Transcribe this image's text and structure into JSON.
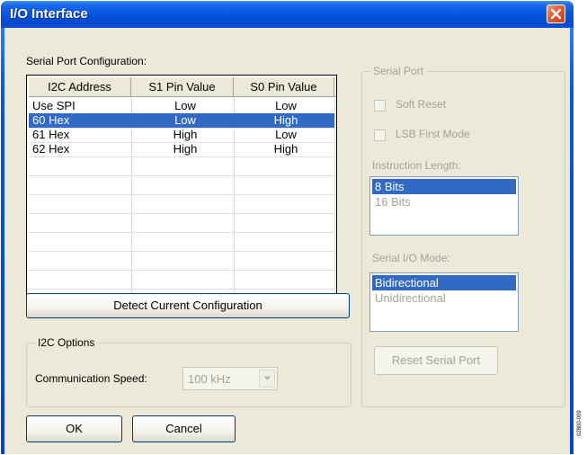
{
  "window": {
    "title": "I/O Interface"
  },
  "serial_config": {
    "label": "Serial Port Configuration:",
    "columns": [
      "I2C Address",
      "S1 Pin Value",
      "S0 Pin Value"
    ],
    "rows": [
      {
        "address": "Use SPI",
        "s1": "Low",
        "s0": "Low",
        "selected": false
      },
      {
        "address": "60 Hex",
        "s1": "Low",
        "s0": "High",
        "selected": true
      },
      {
        "address": "61 Hex",
        "s1": "High",
        "s0": "Low",
        "selected": false
      },
      {
        "address": "62 Hex",
        "s1": "High",
        "s0": "High",
        "selected": false
      }
    ],
    "detect_button": "Detect Current Configuration"
  },
  "i2c_options": {
    "legend": "I2C Options",
    "speed_label": "Communication Speed:",
    "speed_value": "100 kHz"
  },
  "serial_port": {
    "legend": "Serial Port",
    "soft_reset": "Soft Reset",
    "lsb_first": "LSB First Mode",
    "instruction_length_label": "Instruction Length:",
    "instruction_length_options": [
      "8 Bits",
      "16 Bits"
    ],
    "instruction_length_selected": "8 Bits",
    "serial_io_mode_label": "Serial I/O Mode:",
    "serial_io_mode_options": [
      "Bidirectional",
      "Unidirectional"
    ],
    "serial_io_mode_selected": "Bidirectional",
    "reset_button": "Reset Serial Port"
  },
  "footer": {
    "ok": "OK",
    "cancel": "Cancel"
  },
  "side_note": "02800-009",
  "colors": {
    "titlebar": "#0452dd",
    "selection": "#316ac5",
    "face": "#ece9d8",
    "close": "#e3592f"
  }
}
